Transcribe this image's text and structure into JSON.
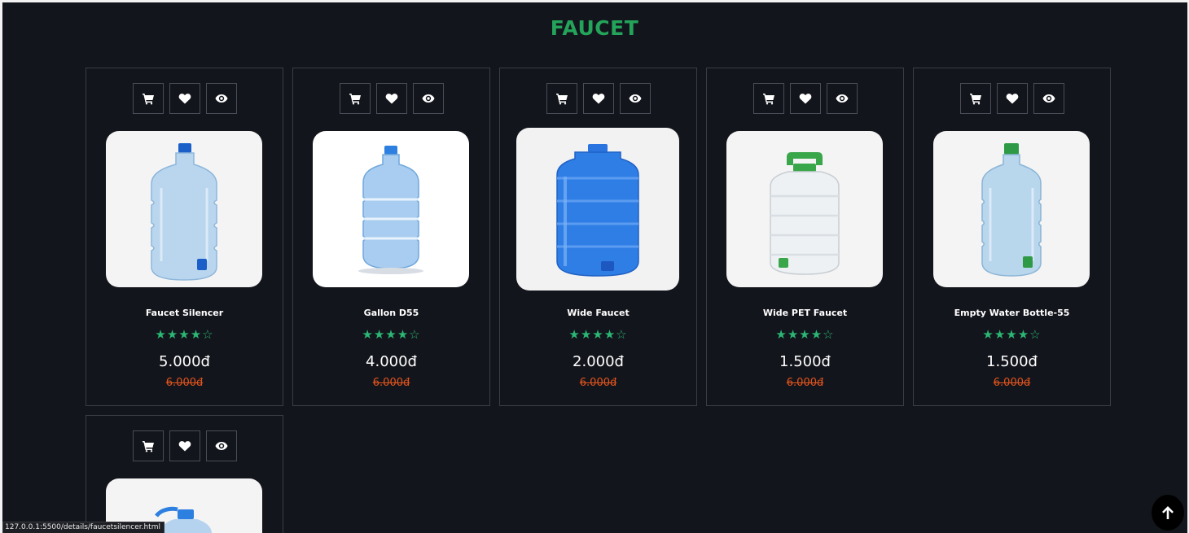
{
  "section": {
    "title": "FAUCET"
  },
  "products": [
    {
      "name": "Faucet Silencer",
      "stars": "★★★★☆",
      "price": "5.000đ",
      "old_price": "6.000đ"
    },
    {
      "name": "Gallon D55",
      "stars": "★★★★☆",
      "price": "4.000đ",
      "old_price": "6.000đ"
    },
    {
      "name": "Wide Faucet",
      "stars": "★★★★☆",
      "price": "2.000đ",
      "old_price": "6.000đ"
    },
    {
      "name": "Wide PET Faucet",
      "stars": "★★★★☆",
      "price": "1.500đ",
      "old_price": "6.000đ"
    },
    {
      "name": "Empty Water Bottle-55",
      "stars": "★★★★☆",
      "price": "1.500đ",
      "old_price": "6.000đ"
    }
  ],
  "rating": 4.5,
  "icons": {
    "cart": "cart-icon",
    "wishlist": "heart-icon",
    "view": "eye-icon",
    "back_top": "arrow-up-icon"
  },
  "colors": {
    "title": "#24a35a",
    "stars": "#2bb673",
    "old_price": "#e2541c",
    "background": "#13151c"
  },
  "status_bar": {
    "url": "127.0.0.1:5500/details/faucetsilencer.html"
  }
}
